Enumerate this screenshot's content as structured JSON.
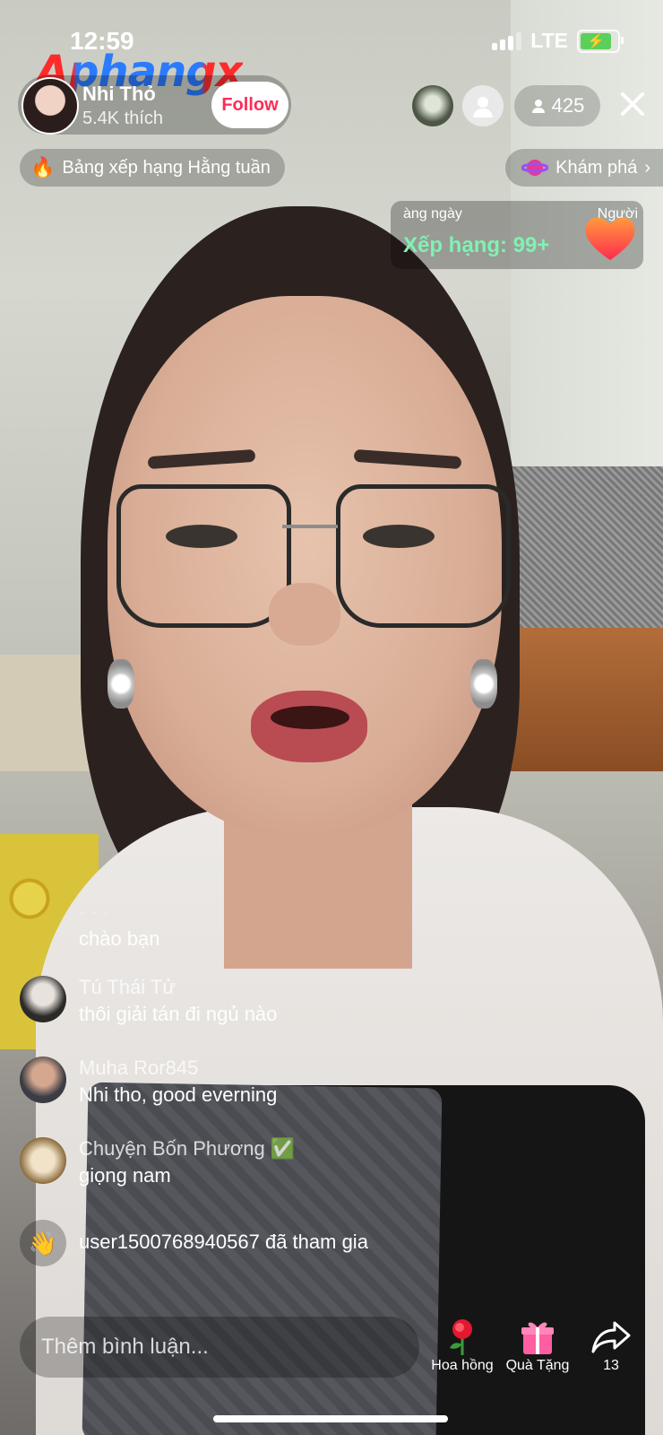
{
  "status_bar": {
    "time": "12:59",
    "network": "LTE"
  },
  "watermark": "Aphangx",
  "host": {
    "name": "Nhi Thỏ",
    "likes": "5.4K thích",
    "follow_label": "Follow"
  },
  "viewers": {
    "count": "425"
  },
  "banners": {
    "weekly_rank": "Bảng xếp hạng Hằng tuần",
    "explore": "Khám phá",
    "daily_label": "àng ngày",
    "daily_label_right": "Người",
    "daily_rank": "Xếp hạng: 99+"
  },
  "comments": [
    {
      "user": "",
      "text": "chào bạn"
    },
    {
      "user": "Tú Thái Tử",
      "text": "thôi giải tán đi ngủ nào"
    },
    {
      "user": "Muha Ror845",
      "text": "Nhi tho, good everning"
    },
    {
      "user": "Chuyện Bốn Phương ✅",
      "text": "giọng nam"
    }
  ],
  "join_notice": "user1500768940567 đã tham gia",
  "comment_input": {
    "placeholder": "Thêm bình luận..."
  },
  "actions": {
    "rose_label": "Hoa hồng",
    "gift_label": "Quà Tặng",
    "share_count": "13"
  },
  "colors": {
    "follow": "#fe2c55",
    "rank_text": "#7ff2b3",
    "battery": "#5ad05a"
  }
}
